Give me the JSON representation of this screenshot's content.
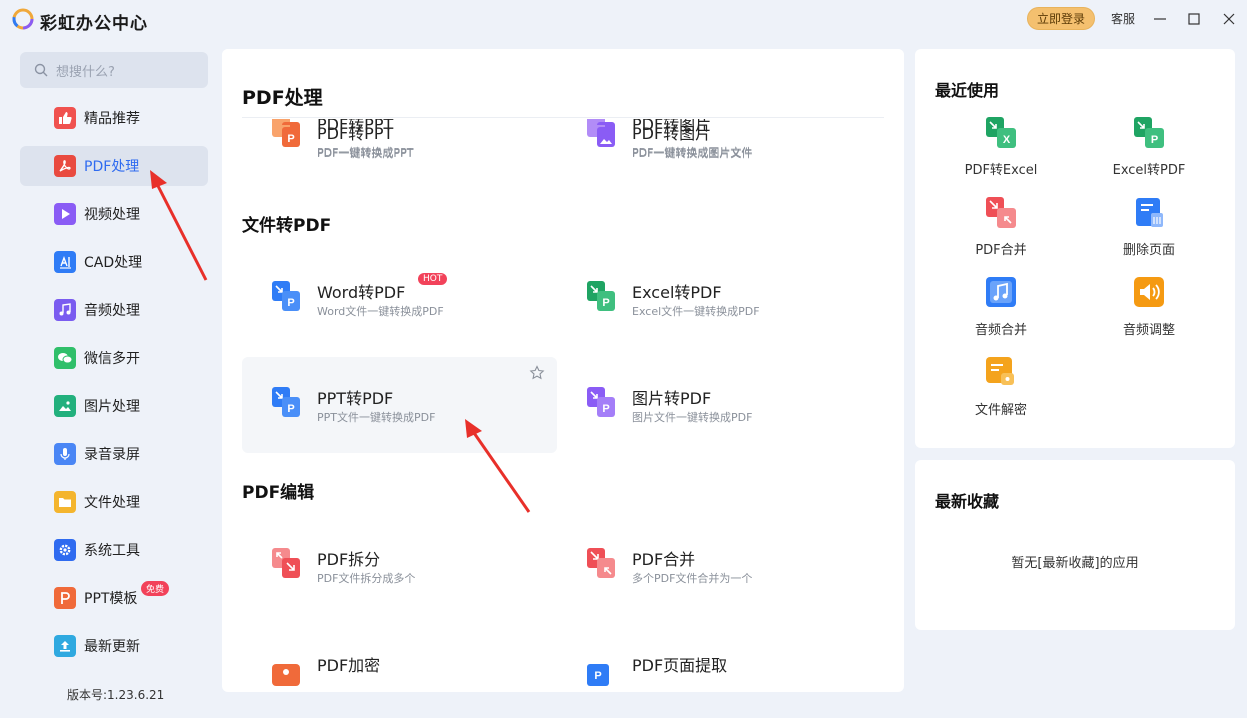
{
  "titlebar": {
    "app_name": "彩虹办公中心",
    "login_label": "立即登录",
    "service_label": "客服"
  },
  "sidebar": {
    "search_placeholder": "想搜什么?",
    "items": [
      {
        "label": "精品推荐",
        "icon": "thumbs-up-icon",
        "color": "#f0524f"
      },
      {
        "label": "PDF处理",
        "icon": "pdf-icon",
        "color": "#e94a3f",
        "active": true
      },
      {
        "label": "视频处理",
        "icon": "play-icon",
        "color": "#8a5cf5"
      },
      {
        "label": "CAD处理",
        "icon": "cad-icon",
        "color": "#2f7cf6"
      },
      {
        "label": "音频处理",
        "icon": "music-icon",
        "color": "#7a5cf0"
      },
      {
        "label": "微信多开",
        "icon": "wechat-icon",
        "color": "#2fbf6a"
      },
      {
        "label": "图片处理",
        "icon": "image-icon",
        "color": "#22b07d"
      },
      {
        "label": "录音录屏",
        "icon": "microphone-icon",
        "color": "#4a86f5"
      },
      {
        "label": "文件处理",
        "icon": "folder-icon",
        "color": "#f4b52e"
      },
      {
        "label": "系统工具",
        "icon": "gear-icon",
        "color": "#2f6bf0"
      },
      {
        "label": "PPT模板",
        "icon": "ppt-icon",
        "color": "#f06a3a",
        "badge": "免费"
      },
      {
        "label": "最新更新",
        "icon": "upload-icon",
        "color": "#2fa9e0"
      }
    ],
    "version": "版本号:1.23.6.21"
  },
  "main": {
    "title": "PDF处理",
    "top_cards": [
      {
        "title": "PDF转PPT",
        "desc": "PDF一键转换成PPT",
        "icon": "pdf-to-ppt-icon"
      },
      {
        "title": "PDF转图片",
        "desc": "PDF一键转换成图片文件",
        "icon": "pdf-to-image-icon"
      }
    ],
    "section_file_to_pdf": "文件转PDF",
    "file_cards": [
      {
        "title": "Word转PDF",
        "desc": "Word文件一键转换成PDF",
        "icon": "word-to-pdf-icon",
        "badge": "HOT"
      },
      {
        "title": "Excel转PDF",
        "desc": "Excel文件一键转换成PDF",
        "icon": "excel-to-pdf-icon"
      },
      {
        "title": "PPT转PDF",
        "desc": "PPT文件一键转换成PDF",
        "icon": "ppt-to-pdf-icon"
      },
      {
        "title": "图片转PDF",
        "desc": "图片文件一键转换成PDF",
        "icon": "image-to-pdf-icon"
      }
    ],
    "section_pdf_edit": "PDF编辑",
    "edit_cards": [
      {
        "title": "PDF拆分",
        "desc": "PDF文件拆分成多个",
        "icon": "pdf-split-icon"
      },
      {
        "title": "PDF合并",
        "desc": "多个PDF文件合并为一个",
        "icon": "pdf-merge-icon"
      },
      {
        "title": "PDF加密",
        "desc": "",
        "icon": "pdf-encrypt-icon"
      },
      {
        "title": "PDF页面提取",
        "desc": "",
        "icon": "pdf-extract-icon"
      }
    ]
  },
  "recent": {
    "title": "最近使用",
    "tools": [
      {
        "label": "PDF转Excel",
        "icon": "pdf-to-excel-icon",
        "color": "#1fa463"
      },
      {
        "label": "Excel转PDF",
        "icon": "excel-to-pdf-icon",
        "color": "#1fa463"
      },
      {
        "label": "PDF合并",
        "icon": "pdf-merge-icon",
        "color": "#ef4f56"
      },
      {
        "label": "删除页面",
        "icon": "delete-page-icon",
        "color": "#2f7cf6"
      },
      {
        "label": "音频合并",
        "icon": "audio-merge-icon",
        "color": "#2f7cf6"
      },
      {
        "label": "音频调整",
        "icon": "audio-adjust-icon",
        "color": "#f59a12"
      },
      {
        "label": "文件解密",
        "icon": "file-decrypt-icon",
        "color": "#f4a31d"
      }
    ]
  },
  "favorites": {
    "title": "最新收藏",
    "empty_text": "暂无[最新收藏]的应用"
  }
}
